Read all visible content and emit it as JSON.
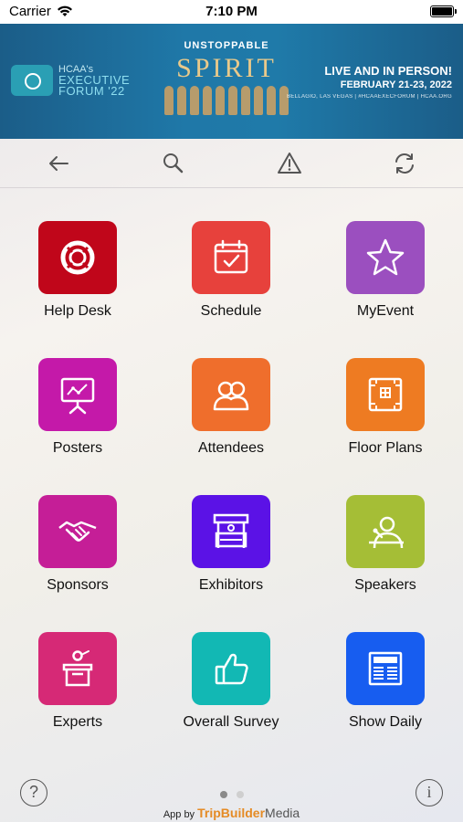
{
  "status_bar": {
    "carrier": "Carrier",
    "time": "7:10 PM"
  },
  "banner": {
    "logo_line1": "HCAA's",
    "logo_line2": "EXECUTIVE",
    "logo_line3": "FORUM '22",
    "kicker": "UNSTOPPABLE",
    "title": "SPIRIT",
    "live": "LIVE AND IN PERSON!",
    "dates": "FEBRUARY 21-23, 2022",
    "small": "BELLAGIO, LAS VEGAS | #HCAAEXECFORUM | HCAA.ORG"
  },
  "toolbar": {
    "back_icon": "back-arrow-icon",
    "search_icon": "search-icon",
    "alert_icon": "alert-triangle-icon",
    "refresh_icon": "refresh-icon"
  },
  "tiles": [
    {
      "label": "Help Desk",
      "color": "#c0061a",
      "icon": "lifebuoy-icon"
    },
    {
      "label": "Schedule",
      "color": "#e7413c",
      "icon": "calendar-check-icon"
    },
    {
      "label": "MyEvent",
      "color": "#9b4fbf",
      "icon": "star-icon"
    },
    {
      "label": "Posters",
      "color": "#c419a9",
      "icon": "presentation-board-icon"
    },
    {
      "label": "Attendees",
      "color": "#ef6e2c",
      "icon": "people-icon"
    },
    {
      "label": "Floor Plans",
      "color": "#ee7b22",
      "icon": "floor-plan-icon"
    },
    {
      "label": "Sponsors",
      "color": "#c51e97",
      "icon": "handshake-icon"
    },
    {
      "label": "Exhibitors",
      "color": "#5b12e6",
      "icon": "booth-icon"
    },
    {
      "label": "Speakers",
      "color": "#a5be36",
      "icon": "speaker-person-icon"
    },
    {
      "label": "Experts",
      "color": "#d62976",
      "icon": "podium-icon"
    },
    {
      "label": "Overall Survey",
      "color": "#12b8b4",
      "icon": "thumbs-up-icon"
    },
    {
      "label": "Show Daily",
      "color": "#175df0",
      "icon": "newspaper-icon"
    }
  ],
  "footer": {
    "help_symbol": "?",
    "info_symbol": "i",
    "app_by": "App by",
    "brand_main": "TripBuilder",
    "brand_suffix": "Media",
    "page_dots": {
      "total": 2,
      "active": 1
    },
    "dot_active_color": "#8a8a8a",
    "dot_inactive_color": "#cfcfcf"
  }
}
